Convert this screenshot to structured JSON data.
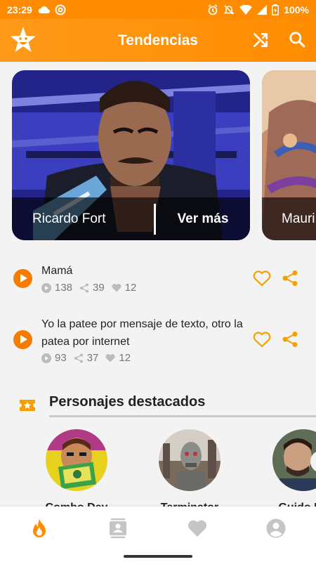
{
  "status_bar": {
    "time": "23:29",
    "battery": "100%",
    "icons": [
      "cloud-icon",
      "app-notification-icon",
      "alarm-icon",
      "mute-icon",
      "wifi-icon",
      "signal-icon",
      "battery-icon"
    ]
  },
  "app_bar": {
    "title": "Tendencias",
    "icons": [
      "star-logo-icon",
      "shuffle-icon",
      "search-icon"
    ]
  },
  "carousel": {
    "cards": [
      {
        "name": "Ricardo Fort",
        "action": "Ver más"
      },
      {
        "name": "Mauri",
        "action": ""
      }
    ]
  },
  "tracks": [
    {
      "title": "Mamá",
      "plays": "138",
      "shares": "39",
      "likes": "12"
    },
    {
      "title": "Yo la patee por mensaje de texto, otro la patea por internet",
      "plays": "93",
      "shares": "37",
      "likes": "12"
    }
  ],
  "featured": {
    "title": "Personajes destacados",
    "people": [
      {
        "name": "Combo Dey"
      },
      {
        "name": "Terminator"
      },
      {
        "name": "Guido Ka"
      }
    ]
  },
  "bottom_nav": {
    "items": [
      "fire-icon",
      "contacts-icon",
      "heart-icon",
      "account-icon"
    ],
    "active": "fire-icon"
  },
  "colors": {
    "accent": "#ff8c00",
    "play": "#f57c00",
    "text": "#222222",
    "muted": "#777777"
  }
}
